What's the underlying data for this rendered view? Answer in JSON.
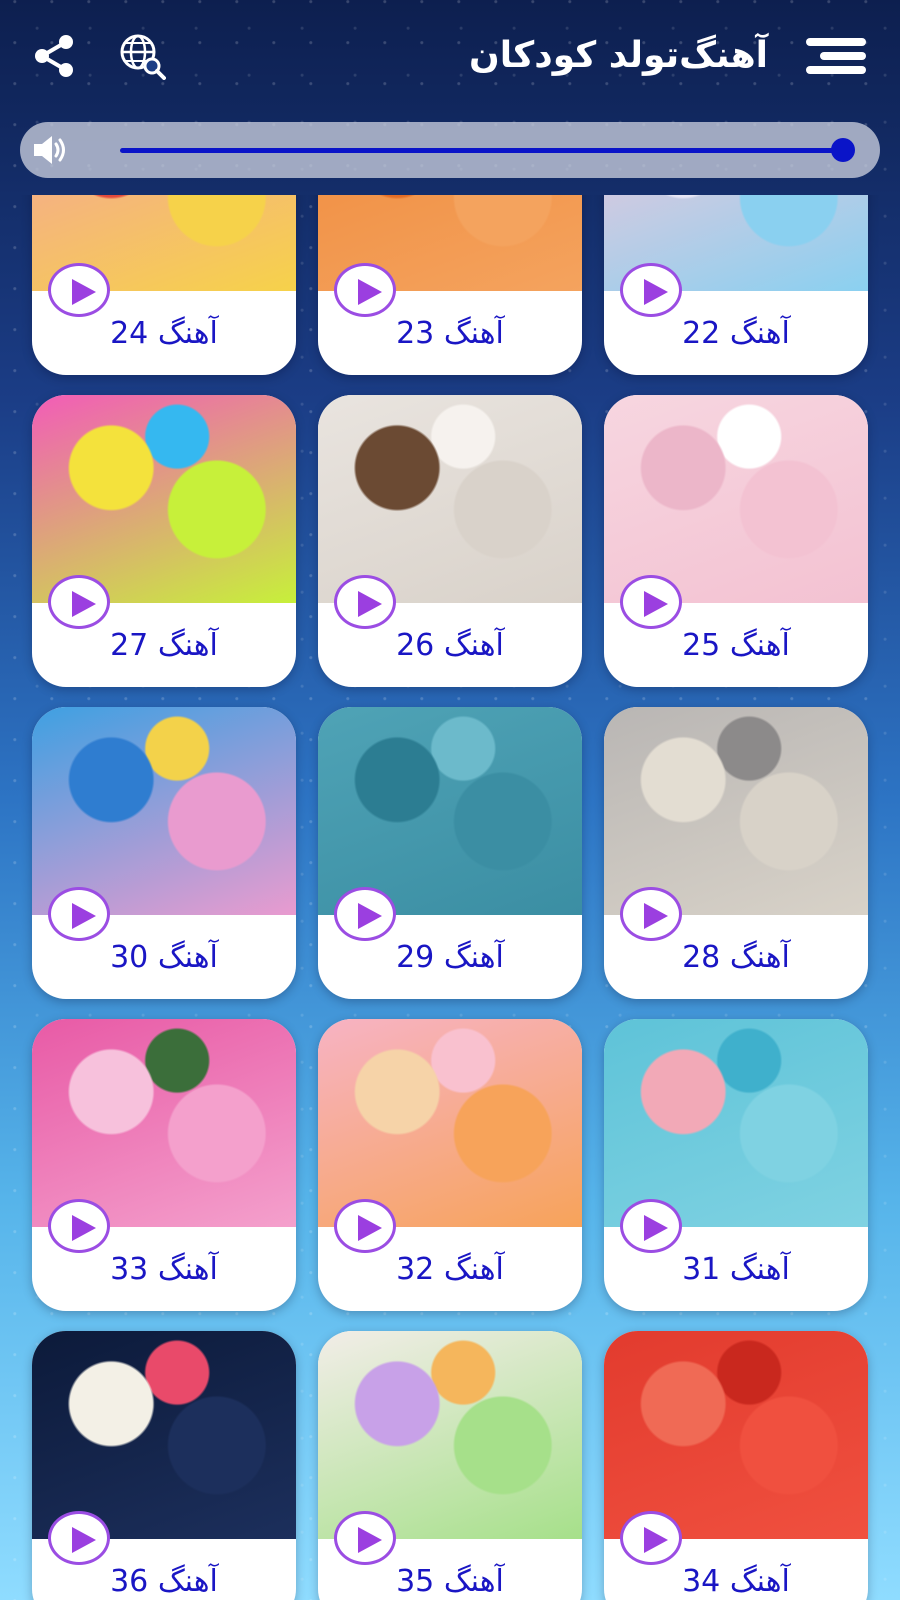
{
  "app": {
    "title": "آهنگ‌تولد کودکان"
  },
  "icons": {
    "menu": "menu-icon",
    "share": "share-icon",
    "globe": "globe-search-icon",
    "volume": "volume-icon",
    "play": "play-icon"
  },
  "player": {
    "volume_level": 1.0,
    "accent_color": "#0a14c8"
  },
  "colors": {
    "label_text": "#1a16c4",
    "play_accent": "#9b4de3",
    "card_bg": "#ffffff"
  },
  "songs": [
    {
      "label": "آهنگ 22",
      "theme": "sprinkles",
      "colors": [
        "#f6c7d9",
        "#8ad0f0",
        "#f3a6c8",
        "#e6e6f5"
      ]
    },
    {
      "label": "آهنگ 23",
      "theme": "party-orange",
      "colors": [
        "#f08a3c",
        "#f4a35e",
        "#ffffff",
        "#e36d26"
      ]
    },
    {
      "label": "آهنگ 24",
      "theme": "rainbow-cake",
      "colors": [
        "#f4a0a0",
        "#f6d24a",
        "#7cc86a",
        "#e24a3c"
      ]
    },
    {
      "label": "آهنگ 25",
      "theme": "unicorn-cat-cake",
      "colors": [
        "#f7d6e0",
        "#f3c2d2",
        "#ffffff",
        "#ecb6c9"
      ]
    },
    {
      "label": "آهنگ 26",
      "theme": "baby-cupcake",
      "colors": [
        "#e9e4df",
        "#d9d2ca",
        "#f6f2ee",
        "#6b4a33"
      ]
    },
    {
      "label": "آهنگ 27",
      "theme": "balloons-colorful",
      "colors": [
        "#f25cb8",
        "#c7f03a",
        "#35b8f0",
        "#f4e23c"
      ]
    },
    {
      "label": "آهنگ 28",
      "theme": "dog-party",
      "colors": [
        "#b9b6b4",
        "#d8d2c8",
        "#8c8a8a",
        "#e3ddd2"
      ]
    },
    {
      "label": "آهنگ 29",
      "theme": "teal-balloon",
      "colors": [
        "#4fa3b6",
        "#3b8ea3",
        "#6cbacb",
        "#2c7d92"
      ]
    },
    {
      "label": "آهنگ 30",
      "theme": "lego-party",
      "colors": [
        "#3ea0e2",
        "#e99bcf",
        "#f3d24a",
        "#2f7dd0"
      ]
    },
    {
      "label": "آهنگ 31",
      "theme": "girl-cake",
      "colors": [
        "#5ec3d8",
        "#7fd2e2",
        "#3fb0cc",
        "#f2a9b7"
      ]
    },
    {
      "label": "آهنگ 32",
      "theme": "smiley-balloons",
      "colors": [
        "#f7b3c4",
        "#f7a35a",
        "#f9c1cf",
        "#f6d3a8"
      ]
    },
    {
      "label": "آهنگ 33",
      "theme": "birthday-cupcakes",
      "colors": [
        "#e85aa6",
        "#f4a0cc",
        "#3b6e3a",
        "#f7c1dc"
      ]
    },
    {
      "label": "آهنگ 34",
      "theme": "gift-box",
      "colors": [
        "#e23b2e",
        "#f0503f",
        "#c9281e",
        "#f06a55"
      ]
    },
    {
      "label": "آهنگ 35",
      "theme": "gift-bag",
      "colors": [
        "#f2ede8",
        "#a6e08a",
        "#f5b65c",
        "#c8a1e8"
      ]
    },
    {
      "label": "آهنگ 36",
      "theme": "fireworks",
      "colors": [
        "#0c1a3a",
        "#1c2f5c",
        "#e94a6a",
        "#f3f0e6"
      ]
    }
  ]
}
